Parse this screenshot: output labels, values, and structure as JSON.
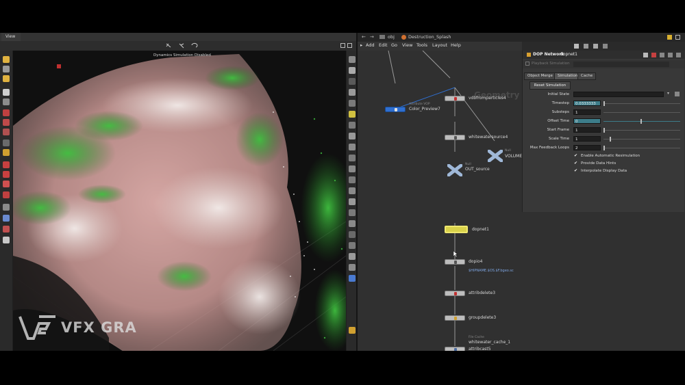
{
  "viewport": {
    "tab_label": "View",
    "sim_message": "Dynamics Simulation Disabled",
    "watermark_text": "VFX GRA"
  },
  "network": {
    "path_root": "obj",
    "path_node": "Destruction_Splash",
    "menu": [
      "Add",
      "Edit",
      "Go",
      "View",
      "Tools",
      "Layout",
      "Help"
    ],
    "ghost_text": "Geometry",
    "nodes": {
      "color_preview": {
        "type": "Attribute VOP",
        "name": "Color_Preview7"
      },
      "vdbfromparticles": {
        "name": "vdbfromparticles4"
      },
      "whitewatersource": {
        "name": "whitewatersource4"
      },
      "out_source": {
        "type": "Null",
        "name": "OUT_source"
      },
      "volume": {
        "type": "Null",
        "name": "VOLUME"
      },
      "dopnet": {
        "name": "dopnet1"
      },
      "dopio": {
        "name": "dopio4",
        "path": "$HIPNAME.$OS.$F.bgeo.sc"
      },
      "attribdelete": {
        "name": "attribdelete3"
      },
      "groupdelete": {
        "name": "groupdelete3"
      },
      "attribcast": {
        "name": "attribcast5"
      },
      "cache": {
        "type": "File Cache",
        "name": "whitewater_cache_1"
      }
    }
  },
  "params": {
    "node_type": "DOP Network",
    "node_name": "dopnet1",
    "playback_label": "Playback Simulation",
    "tabs": [
      "Object Merge",
      "Simulation",
      "Cache"
    ],
    "reset_button": "Reset Simulation",
    "rows": [
      {
        "label": "Initial State",
        "value": ""
      },
      {
        "label": "Timestep",
        "value": "0.0333333"
      },
      {
        "label": "Substeps",
        "value": "1"
      },
      {
        "label": "Offset Time",
        "value": "0"
      },
      {
        "label": "Start Frame",
        "value": "1"
      },
      {
        "label": "Scale Time",
        "value": "1"
      },
      {
        "label": "Max Feedback Loops",
        "value": "2"
      }
    ],
    "checkboxes": [
      {
        "label": "Enable Automatic Resimulation",
        "checked": true
      },
      {
        "label": "Provide Data Hints",
        "checked": true
      },
      {
        "label": "Interpolate Display Data",
        "checked": true
      }
    ]
  },
  "colors": {
    "accent": "#3a8fd0",
    "selected_node": "#d9d24a",
    "cache_node": "#e8c77a",
    "vop_node": "#2f6fd0"
  }
}
